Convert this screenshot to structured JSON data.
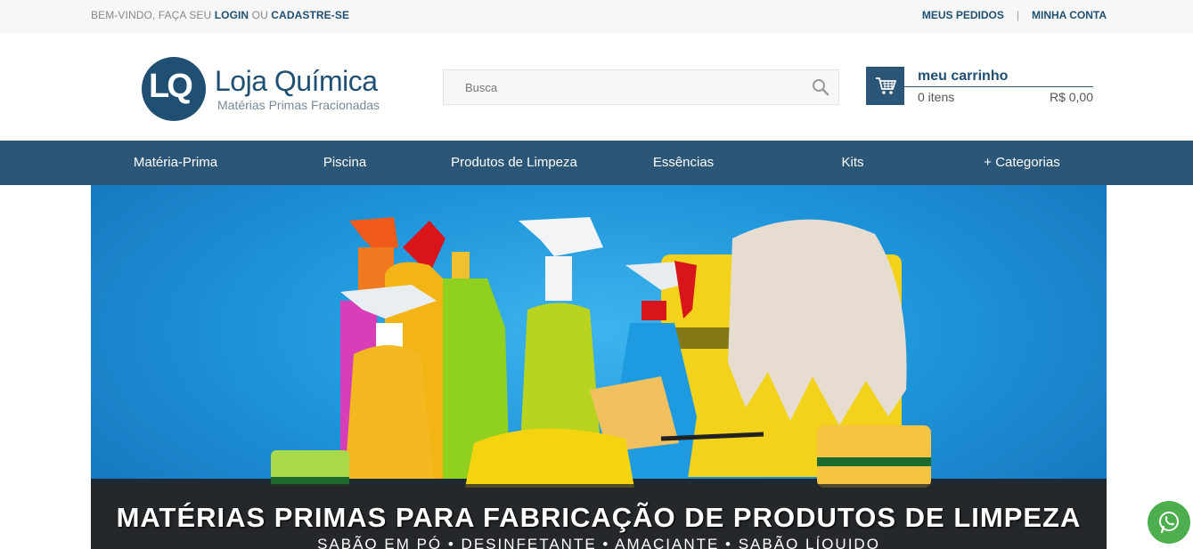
{
  "topbar": {
    "welcome_prefix": "Bem-vindo, faça seu",
    "login_label": "Login",
    "or_label": "ou",
    "register_label": "Cadastre-se",
    "orders_label": "Meus pedidos",
    "separator": "|",
    "account_label": "Minha conta"
  },
  "logo": {
    "initials": "LQ",
    "name": "Loja Química",
    "tagline": "Matérias Primas Fracionadas"
  },
  "search": {
    "placeholder": "Busca",
    "value": ""
  },
  "cart": {
    "title": "meu carrinho",
    "items": "0 itens",
    "total": "R$ 0,00"
  },
  "nav": {
    "items": [
      {
        "label": "Matéria-Prima"
      },
      {
        "label": "Piscina"
      },
      {
        "label": "Produtos de Limpeza"
      },
      {
        "label": "Essências"
      },
      {
        "label": "Kits"
      },
      {
        "label": "+ Categorias"
      }
    ]
  },
  "banner": {
    "headline": "MATÉRIAS PRIMAS PARA FABRICAÇÃO DE PRODUTOS DE LIMPEZA",
    "subline": "SABÃO EM PÓ • DESINFETANTE • AMACIANTE • SABÃO LÍQUIDO"
  },
  "colors": {
    "brand": "#1f4f72",
    "nav_bg": "#2c5677",
    "whatsapp": "#4cae4c"
  },
  "icons": [
    "search-icon",
    "cart-icon",
    "whatsapp-icon"
  ]
}
